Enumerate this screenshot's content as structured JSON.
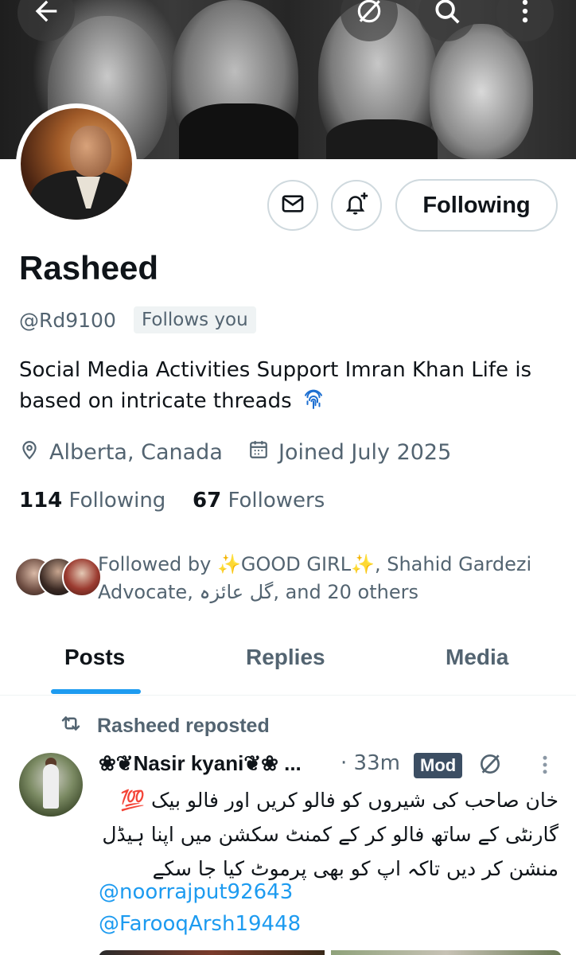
{
  "profile": {
    "name": "Rasheed",
    "handle": "@Rd9100",
    "follows_you": "Follows you",
    "bio": "Social Media Activities  Support Imran Khan  Life is based on intricate threads",
    "location": "Alberta, Canada",
    "joined": "Joined July 2025",
    "following_count": "114",
    "following_label": "Following",
    "followers_count": "67",
    "followers_label": "Followers",
    "followed_by": "Followed by ✨GOOD GIRL✨, Shahid Gardezi Advocate, گل عائزہ, and 20 others"
  },
  "actions": {
    "following_button": "Following"
  },
  "tabs": [
    {
      "label": "Posts",
      "active": true
    },
    {
      "label": "Replies",
      "active": false
    },
    {
      "label": "Media",
      "active": false
    }
  ],
  "post": {
    "repost_label": "Rasheed reposted",
    "author": "❀❦Nasir kyani❦❀ ...",
    "time": "· 33m",
    "badge": "Mod",
    "text": "خان صاحب کی شیروں کو فالو کریں اور فالو بیک 💯 گارنٹی کے ساتھ فالو کر کے کمنٹ سکشن میں اپنا ہیڈل منشن کر دیں تاکہ اپ کو بھی پرموٹ کیا جا سکے",
    "mentions": [
      "@noorrajput92643",
      "@FarooqArsh19448"
    ]
  },
  "colors": {
    "accent": "#1d9bf0",
    "text_primary": "#0f1419",
    "text_secondary": "#536471",
    "badge_bg": "#3c4e63"
  },
  "icons": [
    "back-arrow-icon",
    "grok-icon",
    "search-icon",
    "more-vertical-icon",
    "mail-icon",
    "bell-plus-icon",
    "location-icon",
    "calendar-icon",
    "repost-icon",
    "fingerprint-icon"
  ]
}
